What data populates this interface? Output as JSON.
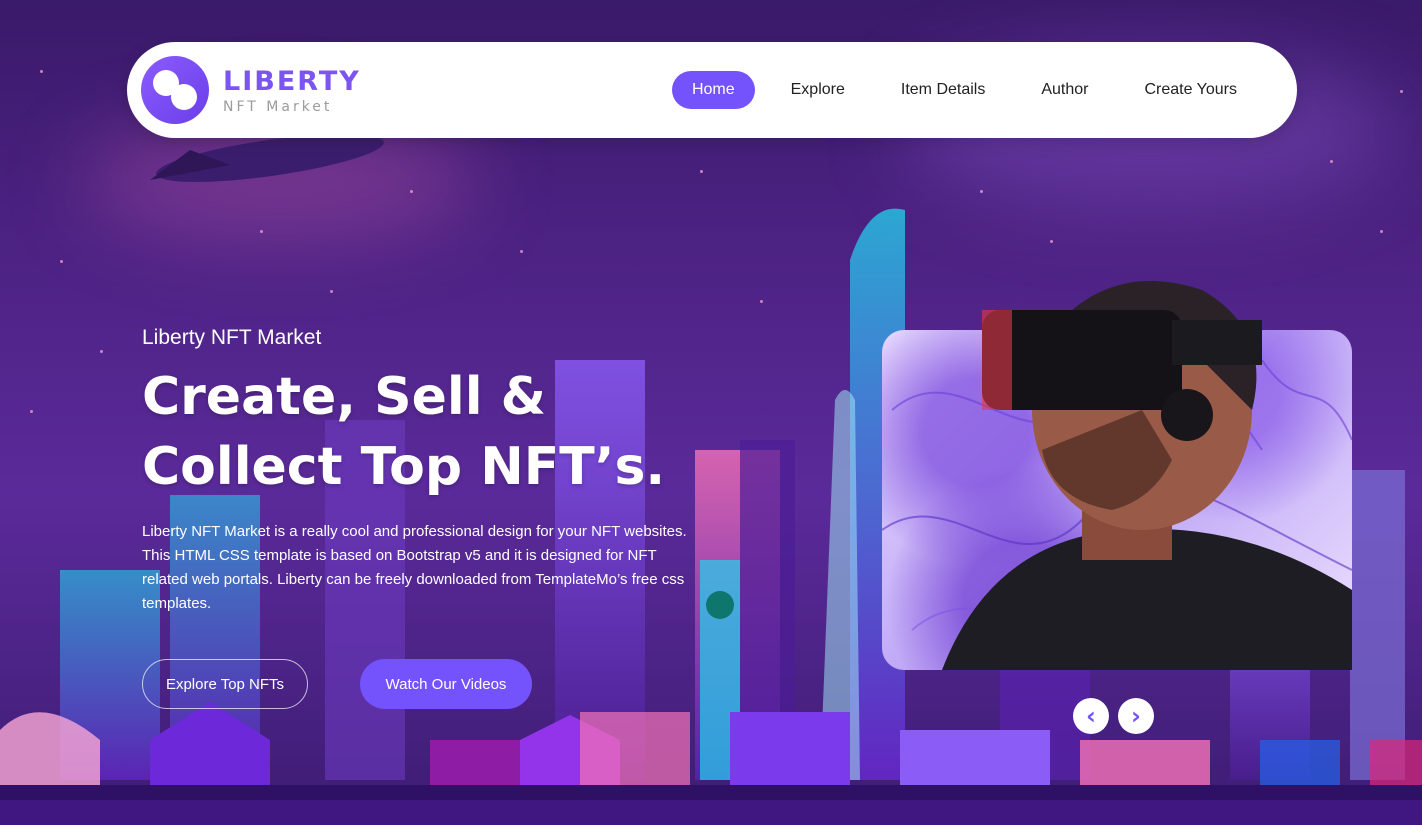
{
  "brand": {
    "title": "LIBERTY",
    "subtitle": "NFT Market"
  },
  "nav": {
    "items": [
      {
        "label": "Home",
        "active": true
      },
      {
        "label": "Explore"
      },
      {
        "label": "Item Details"
      },
      {
        "label": "Author"
      },
      {
        "label": "Create Yours"
      }
    ]
  },
  "hero": {
    "eyebrow": "Liberty NFT Market",
    "heading_line1": "Create, Sell &",
    "heading_line2": "Collect Top NFT’s.",
    "description": "Liberty NFT Market is a really cool and professional design for your NFT websites. This HTML CSS template is based on Bootstrap v5 and it is designed for NFT related web portals. Liberty can be freely downloaded from TemplateMo’s free css templates.",
    "btn_explore": "Explore Top NFTs",
    "btn_watch": "Watch Our Videos"
  },
  "carousel": {
    "prev_icon": "chevron-left-icon",
    "next_icon": "chevron-right-icon"
  },
  "colors": {
    "accent": "#7453fc",
    "brand": "#7b54f2"
  }
}
